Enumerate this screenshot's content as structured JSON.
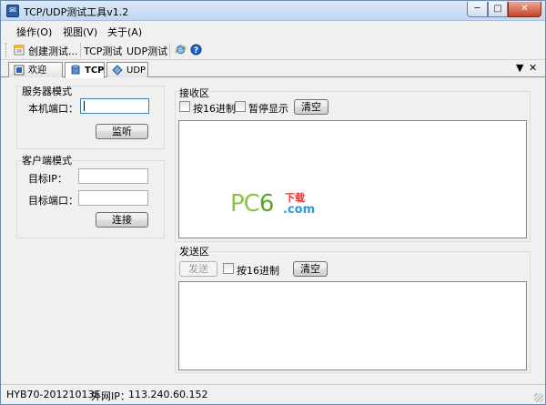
{
  "window": {
    "title": "TCP/UDP测试工具v1.2",
    "controls": {
      "minimize": "─",
      "maximize": "□",
      "close": "✕"
    }
  },
  "menu": [
    "操作(O)",
    "视图(V)",
    "关于(A)"
  ],
  "toolbar": {
    "new_test": "创建测试...",
    "tcp_test": "TCP测试",
    "udp_test": "UDP测试",
    "icons": [
      "new-test-icon",
      "ie-icon",
      "help-icon"
    ]
  },
  "tabs": [
    {
      "label": "欢迎",
      "icon": "welcome-page-icon",
      "active": false
    },
    {
      "label": "TCP",
      "icon": "tcp-cylinder-icon",
      "active": true
    },
    {
      "label": "UDP",
      "icon": "udp-diamond-icon",
      "active": false
    }
  ],
  "tab_controls": {
    "dropdown": "▼",
    "close": "✕"
  },
  "server": {
    "title": "服务器模式",
    "port_label": "本机端口：",
    "port_value": "",
    "listen_button": "监听"
  },
  "client": {
    "title": "客户端模式",
    "ip_label": "目标IP：",
    "ip_value": "",
    "port_label": "目标端口：",
    "port_value": "",
    "connect_button": "连接"
  },
  "receive": {
    "title": "接收区",
    "hex_label": "按16进制",
    "pause_label": "暂停显示",
    "clear_button": "清空",
    "content": ""
  },
  "send": {
    "title": "发送区",
    "send_button": "发送",
    "hex_label": "按16进制",
    "clear_button": "清空",
    "content": ""
  },
  "watermark": {
    "pc": "PC",
    "six": "6",
    "download": "下载",
    "com": ".com"
  },
  "status": {
    "host": "HYB70-20121013E",
    "ip_label": "外网IP：",
    "ip_value": "113.240.60.152"
  },
  "colors": {
    "accent": "#3c7fb1",
    "close_red": "#c8442a",
    "watermark_green": "#8cc63f",
    "watermark_blue": "#2a9bd7"
  }
}
